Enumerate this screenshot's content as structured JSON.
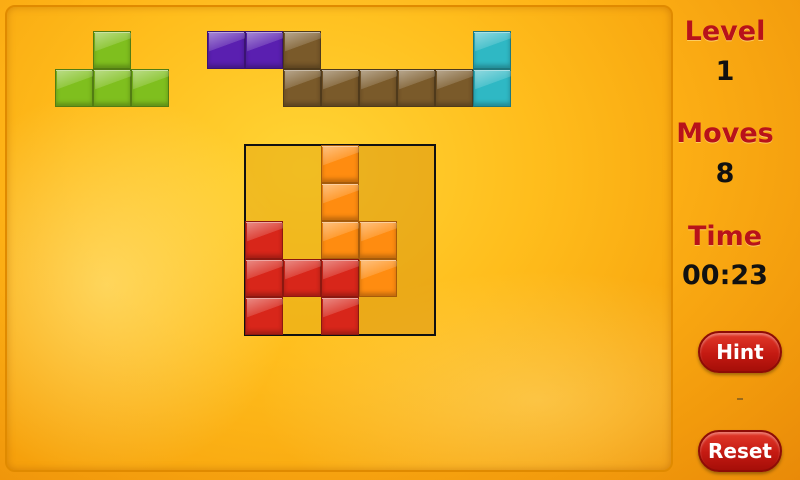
{
  "side_panel": {
    "level_label": "Level",
    "level_value": "1",
    "moves_label": "Moves",
    "moves_value": "8",
    "time_label": "Time",
    "time_value": "00:23",
    "hint_button": "Hint",
    "separator": "-",
    "reset_button": "Reset"
  },
  "colors": {
    "green": "#7fbf1e",
    "purple": "#5a1fb0",
    "brown": "#7a5a2a",
    "cyan": "#2fb8c4",
    "orange": "#ff8c10",
    "red": "#d8261a",
    "grid_border": "#111111"
  },
  "pieces": [
    {
      "name": "green-t-piece",
      "color": "green"
    },
    {
      "name": "purple-piece",
      "color": "purple"
    },
    {
      "name": "brown-piece",
      "color": "brown"
    },
    {
      "name": "cyan-piece",
      "color": "cyan"
    },
    {
      "name": "orange-piece",
      "color": "orange"
    },
    {
      "name": "red-piece",
      "color": "red"
    }
  ]
}
